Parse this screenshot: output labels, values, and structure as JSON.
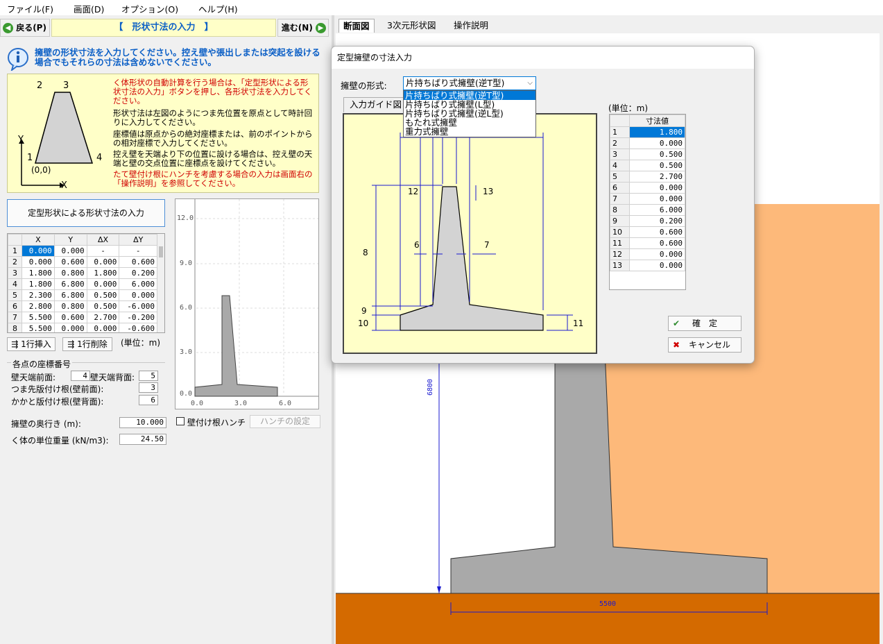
{
  "menu": [
    "ファイル(F)",
    "画面(D)",
    "オプション(O)",
    "ヘルプ(H)"
  ],
  "nav": {
    "back": "戻る(P)",
    "next": "進む(N)",
    "title": "【　形状寸法の入力　】"
  },
  "info": {
    "heading": "擁壁の形状寸法を入力してください。控え壁や張出しまたは突起を設ける場合でもそれらの寸法は含めないでください。"
  },
  "guide": {
    "p1": "く体形状の自動計算を行う場合は、「定型形状による形状寸法の入力」ボタンを押し、各形状寸法を入力してください。",
    "p2": "形状寸法は左図のようにつま先位置を原点として時計回りに入力してください。",
    "p3": "座標値は原点からの絶対座標または、前のポイントからの相対座標で入力してください。",
    "p4": "控え壁を天端より下の位置に設ける場合は、控え壁の天端と壁の交点位置に座標点を設けてください。",
    "p5": "たて壁付け根にハンチを考慮する場合の入力は画面右の「操作説明」を参照してください。",
    "fig": {
      "p1": "1",
      "p2": "2",
      "p3": "3",
      "p4": "4",
      "origin": "(0,0)",
      "x": "X",
      "y": "Y"
    }
  },
  "std_button": "定型形状による形状寸法の入力",
  "coord_table": {
    "headers": [
      "",
      "X",
      "Y",
      "ΔX",
      "ΔY"
    ],
    "rows": [
      [
        "1",
        "0.000",
        "0.000",
        "-",
        "-"
      ],
      [
        "2",
        "0.000",
        "0.600",
        "0.000",
        "0.600"
      ],
      [
        "3",
        "1.800",
        "0.800",
        "1.800",
        "0.200"
      ],
      [
        "4",
        "1.800",
        "6.800",
        "0.000",
        "6.000"
      ],
      [
        "5",
        "2.300",
        "6.800",
        "0.500",
        "0.000"
      ],
      [
        "6",
        "2.800",
        "0.800",
        "0.500",
        "-6.000"
      ],
      [
        "7",
        "5.500",
        "0.600",
        "2.700",
        "-0.200"
      ],
      [
        "8",
        "5.500",
        "0.000",
        "0.000",
        "-0.600"
      ]
    ]
  },
  "row_buttons": {
    "insert": "1行挿入",
    "delete": "1行削除",
    "unit": "(単位：m)"
  },
  "preview_axis": {
    "y": [
      "12.0",
      "9.0",
      "6.0",
      "3.0",
      "0.0"
    ],
    "x": [
      "0.0",
      "3.0",
      "6.0"
    ]
  },
  "points": {
    "title": "各点の座標番号",
    "top_front_label": "壁天端前面:",
    "top_front": "4",
    "top_back_label": "壁天端背面:",
    "top_back": "5",
    "toe_label": "つま先版付け根(壁前面):",
    "toe": "3",
    "heel_label": "かかと版付け根(壁背面):",
    "heel": "6"
  },
  "depth": {
    "label": "擁壁の奥行き (m):",
    "value": "10.000"
  },
  "weight": {
    "label": "く体の単位重量 (kN/m3):",
    "value": "24.50"
  },
  "haunch": {
    "checkbox": "壁付け根ハンチ",
    "button": "ハンチの設定"
  },
  "tabs": [
    "断面図",
    "3次元形状図",
    "操作説明"
  ],
  "section": {
    "height_dim": "6800",
    "width_dim": "5500"
  },
  "dialog": {
    "title": "定型擁壁の寸法入力",
    "type_label": "擁壁の形式:",
    "selected": "片持ちばり式擁壁(逆T型)",
    "options": [
      "片持ちばり式擁壁(逆T型)",
      "片持ちばり式擁壁(L型)",
      "片持ちばり式擁壁(逆L型)",
      "もたれ式擁壁",
      "重力式擁壁"
    ],
    "guide_tab": "入力ガイド図",
    "unit": "(単位：m)",
    "table_header": "寸法値",
    "dims": [
      [
        "1",
        "1.800"
      ],
      [
        "2",
        "0.000"
      ],
      [
        "3",
        "0.500"
      ],
      [
        "4",
        "0.500"
      ],
      [
        "5",
        "2.700"
      ],
      [
        "6",
        "0.000"
      ],
      [
        "7",
        "0.000"
      ],
      [
        "8",
        "6.000"
      ],
      [
        "9",
        "0.200"
      ],
      [
        "10",
        "0.600"
      ],
      [
        "11",
        "0.600"
      ],
      [
        "12",
        "0.000"
      ],
      [
        "13",
        "0.000"
      ]
    ],
    "fig_labels": {
      "l12": "12",
      "l13": "13",
      "l8": "8",
      "l6": "6",
      "l7": "7",
      "l9": "9",
      "l10": "10",
      "l11": "11"
    },
    "ok": "確　定",
    "cancel": "キャンセル"
  },
  "colors": {
    "accent": "#0b5fc6",
    "selection": "#0078d7",
    "soil_back": "#fdb97a",
    "soil_ground": "#d46a00",
    "concrete": "#a9a9a9",
    "guide_bg": "#ffffc8"
  }
}
